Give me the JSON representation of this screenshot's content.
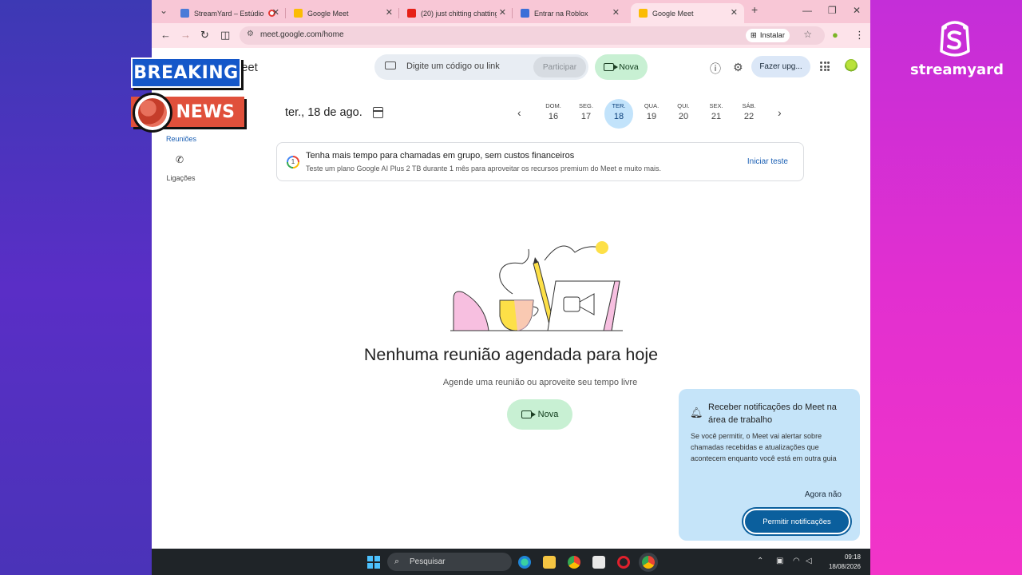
{
  "browser": {
    "tabs": [
      {
        "label": "StreamYard – Estúdio",
        "recording": true,
        "fav_color": "#4a7bd8"
      },
      {
        "label": "Google Meet",
        "fav_color": "#fbbc04"
      },
      {
        "label": "(20) just chitting chatting",
        "fav_color": "#e62117"
      },
      {
        "label": "Entrar na Roblox",
        "fav_color": "#3b6fd8"
      },
      {
        "label": "Google Meet",
        "fav_color": "#fbbc04",
        "active": true
      }
    ],
    "new_tab": "+",
    "url": "meet.google.com/home",
    "install_label": "Instalar"
  },
  "meet": {
    "brand_partial": "eet",
    "join_placeholder": "Digite um código ou link",
    "join_button": "Participar",
    "new_button": "Nova",
    "upgrade_button": "Fazer upg...",
    "sidebar": [
      {
        "label": "Reuniões",
        "selected": true
      },
      {
        "label": "Ligações",
        "selected": false
      }
    ],
    "date_title": "ter., 18 de ago.",
    "week": [
      {
        "name": "DOM.",
        "num": "16"
      },
      {
        "name": "SEG.",
        "num": "17"
      },
      {
        "name": "TER.",
        "num": "18",
        "today": true
      },
      {
        "name": "QUA.",
        "num": "19"
      },
      {
        "name": "QUI.",
        "num": "20"
      },
      {
        "name": "SEX.",
        "num": "21"
      },
      {
        "name": "SÁB.",
        "num": "22"
      }
    ],
    "promo": {
      "title": "Tenha mais tempo para chamadas em grupo, sem custos financeiros",
      "body": "Teste um plano Google AI Plus 2 TB durante 1 mês para aproveitar os recursos premium do Meet e muito mais.",
      "cta": "Iniciar teste"
    },
    "empty_title": "Nenhuma reunião agendada para hoje",
    "empty_sub": "Agende uma reunião ou aproveite seu tempo livre",
    "empty_button": "Nova"
  },
  "notification": {
    "title": "Receber notificações do Meet na área de trabalho",
    "body": "Se você permitir, o Meet vai alertar sobre chamadas recebidas e atualizações que acontecem enquanto você está em outra guia",
    "later": "Agora não",
    "allow": "Permitir notificações"
  },
  "taskbar": {
    "search_placeholder": "Pesquisar",
    "time": "09:18",
    "date": "18/08/2026"
  },
  "overlay": {
    "breaking": "BREAKING",
    "news": "NEWS",
    "brand": "streamyard"
  },
  "colors": {
    "accent_blue": "#1a5fb4",
    "new_green": "#c8f0d3",
    "today_bg": "#c2e3fb",
    "notif_bg": "#c5e4f9",
    "tabstrip": "#f8c7d6"
  }
}
